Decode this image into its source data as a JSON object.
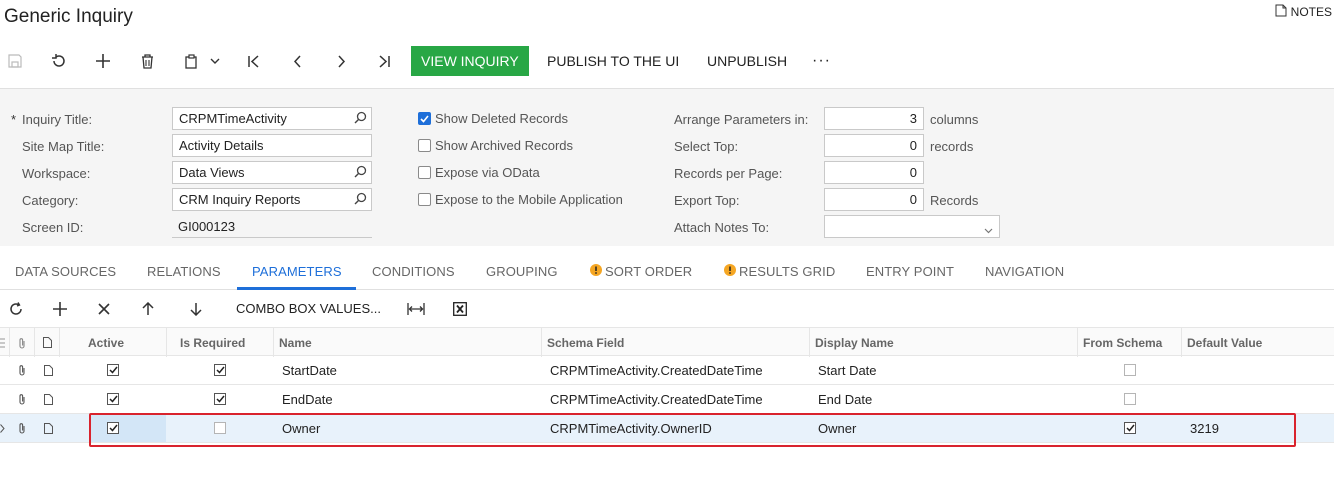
{
  "header": {
    "title": "Generic Inquiry",
    "notes_label": "NOTES"
  },
  "toolbar": {
    "icons": [
      "save-icon",
      "undo-icon",
      "add-icon",
      "delete-icon",
      "copy-paste-icon",
      "first-record-icon",
      "previous-icon",
      "next-icon",
      "last-record-icon",
      "more-icon"
    ],
    "view_inquiry": "VIEW INQUIRY",
    "publish": "PUBLISH TO THE UI",
    "unpublish": "UNPUBLISH",
    "more": "···",
    "accent_color": "#28a745"
  },
  "form": {
    "required_marker": "*",
    "inquiry_title_label": "Inquiry Title:",
    "inquiry_title_value": "CRPMTimeActivity",
    "site_map_title_label": "Site Map Title:",
    "site_map_title_value": "Activity Details",
    "workspace_label": "Workspace:",
    "workspace_value": "Data Views",
    "category_label": "Category:",
    "category_value": "CRM Inquiry Reports",
    "screen_id_label": "Screen ID:",
    "screen_id_value": "GI000123",
    "show_deleted_label": "Show Deleted Records",
    "show_deleted_checked": true,
    "show_archived_label": "Show Archived Records",
    "show_archived_checked": false,
    "expose_odata_label": "Expose via OData",
    "expose_odata_checked": false,
    "expose_mobile_label": "Expose to the Mobile Application",
    "expose_mobile_checked": false,
    "arrange_label": "Arrange Parameters in:",
    "arrange_value": "3",
    "arrange_unit": "columns",
    "select_top_label": "Select Top:",
    "select_top_value": "0",
    "select_top_unit": "records",
    "records_per_page_label": "Records per Page:",
    "records_per_page_value": "0",
    "export_top_label": "Export Top:",
    "export_top_value": "0",
    "export_top_unit": "Records",
    "attach_notes_label": "Attach Notes To:",
    "attach_notes_value": ""
  },
  "tabs": [
    {
      "label": "DATA SOURCES",
      "active": false,
      "warning": false
    },
    {
      "label": "RELATIONS",
      "active": false,
      "warning": false
    },
    {
      "label": "PARAMETERS",
      "active": true,
      "warning": false
    },
    {
      "label": "CONDITIONS",
      "active": false,
      "warning": false
    },
    {
      "label": "GROUPING",
      "active": false,
      "warning": false
    },
    {
      "label": "SORT ORDER",
      "active": false,
      "warning": true
    },
    {
      "label": "RESULTS GRID",
      "active": false,
      "warning": true
    },
    {
      "label": "ENTRY POINT",
      "active": false,
      "warning": false
    },
    {
      "label": "NAVIGATION",
      "active": false,
      "warning": false
    }
  ],
  "grid_toolbar": {
    "icons": [
      "refresh-icon",
      "add-row-icon",
      "delete-row-icon",
      "move-up-icon",
      "move-down-icon",
      "fit-columns-icon",
      "export-excel-icon"
    ],
    "combo_label": "COMBO BOX VALUES..."
  },
  "grid": {
    "columns": [
      "Active",
      "Is Required",
      "Name",
      "Schema Field",
      "Display Name",
      "From Schema",
      "Default Value"
    ],
    "rows": [
      {
        "active": true,
        "is_required": true,
        "name": "StartDate",
        "schema_field": "CRPMTimeActivity.CreatedDateTime",
        "display_name": "Start Date",
        "from_schema": false,
        "default_value": "",
        "selected": false
      },
      {
        "active": true,
        "is_required": true,
        "name": "EndDate",
        "schema_field": "CRPMTimeActivity.CreatedDateTime",
        "display_name": "End Date",
        "from_schema": false,
        "default_value": "",
        "selected": false
      },
      {
        "active": true,
        "is_required": false,
        "name": "Owner",
        "schema_field": "CRPMTimeActivity.OwnerID",
        "display_name": "Owner",
        "from_schema": true,
        "default_value": "3219",
        "selected": true
      }
    ],
    "highlight_color": "#d9232d",
    "selected_row_color": "#e8f2fb"
  }
}
